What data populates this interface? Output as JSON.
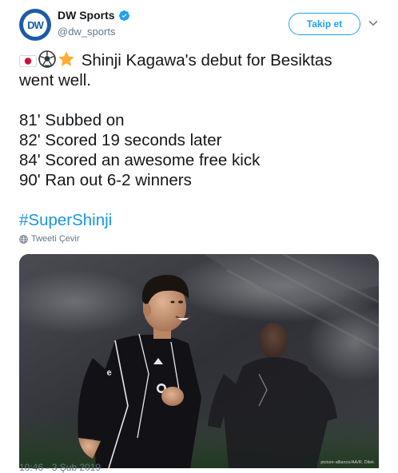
{
  "header": {
    "display_name": "DW Sports",
    "handle": "@dw_sports",
    "avatar_text": "DW",
    "follow_label": "Takip et"
  },
  "tweet": {
    "line1": "Shinji Kagawa's debut for Besiktas",
    "line2": "went well.",
    "events": [
      "81' Subbed on",
      "82' Scored 19 seconds later",
      "84' Scored an awesome free kick",
      "90' Ran out 6-2 winners"
    ],
    "hashtag": "#SuperShinji",
    "emojis": [
      "flag-japan-emoji",
      "soccer-ball-emoji",
      "star-emoji"
    ]
  },
  "translate_label": "Tweeti Çevir",
  "media": {
    "credit": "picture-alliance/AA/R. Dilek",
    "jersey_text": "e"
  },
  "timestamp": "10:46 - 3 Şub 2019",
  "colors": {
    "link_blue": "#1b95e0",
    "follow_blue": "#1da1f2",
    "secondary_gray": "#657786",
    "dw_blue": "#1c5ca6"
  }
}
